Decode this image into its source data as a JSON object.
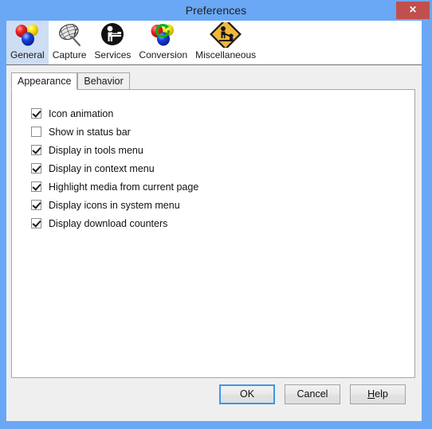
{
  "window": {
    "title": "Preferences",
    "close_label": "✕",
    "accent_color": "#6aa8f5",
    "close_color": "#c0504d"
  },
  "toolbar": {
    "items": [
      {
        "label": "General",
        "icon": "balloons-icon",
        "selected": true
      },
      {
        "label": "Capture",
        "icon": "butterfly-net-icon",
        "selected": false
      },
      {
        "label": "Services",
        "icon": "worker-circle-icon",
        "selected": false
      },
      {
        "label": "Conversion",
        "icon": "balloons-refresh-icon",
        "selected": false
      },
      {
        "label": "Miscellaneous",
        "icon": "roadwork-sign-icon",
        "selected": false
      }
    ]
  },
  "tabs": [
    {
      "label": "Appearance",
      "active": true
    },
    {
      "label": "Behavior",
      "active": false
    }
  ],
  "options": [
    {
      "label": "Icon animation",
      "checked": true
    },
    {
      "label": "Show in status bar",
      "checked": false
    },
    {
      "label": "Display in tools menu",
      "checked": true
    },
    {
      "label": "Display in context menu",
      "checked": true
    },
    {
      "label": "Highlight media from current page",
      "checked": true
    },
    {
      "label": "Display icons in system menu",
      "checked": true
    },
    {
      "label": "Display download counters",
      "checked": true
    }
  ],
  "buttons": {
    "ok": "OK",
    "cancel": "Cancel",
    "help_mnemonic": "H",
    "help_rest": "elp"
  }
}
